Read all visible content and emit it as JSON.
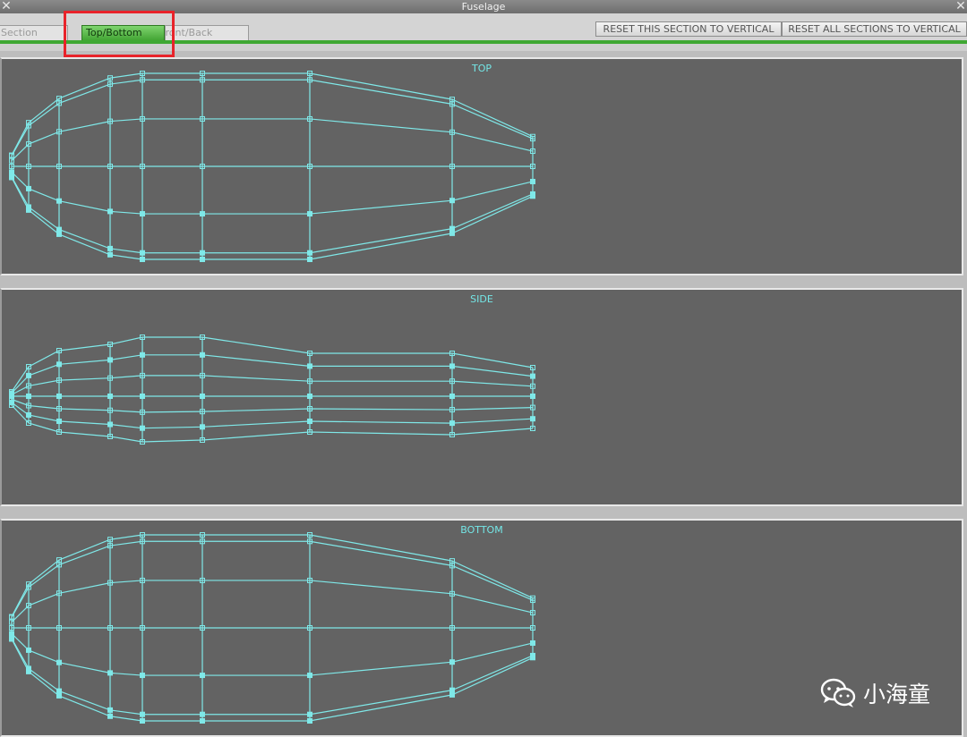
{
  "window": {
    "title": "Fuselage"
  },
  "tabs": [
    {
      "label": "Section",
      "active": false
    },
    {
      "label": "Top/Bottom",
      "active": true
    },
    {
      "label": "Front/Back",
      "active": false
    }
  ],
  "buttons": {
    "reset_this": "RESET THIS SECTION TO VERTICAL",
    "reset_all": "RESET ALL SECTIONS TO VERTICAL"
  },
  "panels": [
    {
      "label": "TOP"
    },
    {
      "label": "SIDE"
    },
    {
      "label": "BOTTOM"
    }
  ],
  "watermark": {
    "text": "小海童",
    "icon": "wechat-icon"
  },
  "colors": {
    "wireframe": "#7fe8e8",
    "panel_bg": "#636363",
    "active_tab": "#49a93a",
    "highlight": "#e8232a"
  }
}
